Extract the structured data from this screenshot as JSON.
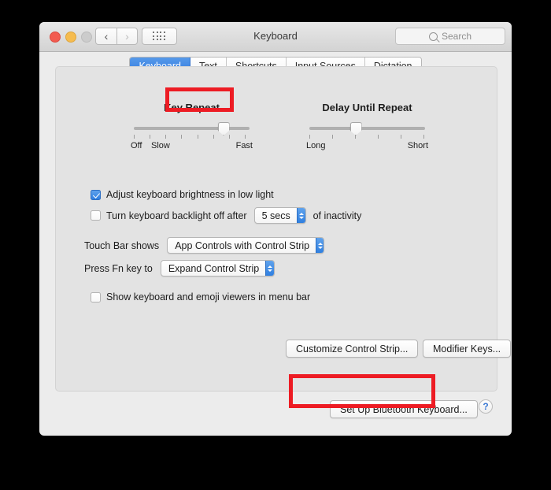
{
  "window": {
    "title": "Keyboard",
    "traffic_lights": [
      "close",
      "minimize",
      "zoom"
    ],
    "nav_back_icon": "chevron-left-icon",
    "nav_forward_icon": "chevron-right-icon",
    "grid_icon": "show-all-grid-icon",
    "search": {
      "placeholder": "Search",
      "value": "",
      "icon": "search-icon"
    }
  },
  "tabs": [
    {
      "label": "Keyboard",
      "active": true
    },
    {
      "label": "Text",
      "active": false
    },
    {
      "label": "Shortcuts",
      "active": false
    },
    {
      "label": "Input Sources",
      "active": false
    },
    {
      "label": "Dictation",
      "active": false
    }
  ],
  "sliders": [
    {
      "title": "Key Repeat",
      "left_label": "Off",
      "second_label": "Slow",
      "right_label": "Fast",
      "ticks": 8,
      "value_index": 7
    },
    {
      "title": "Delay Until Repeat",
      "left_label": "Long",
      "right_label": "Short",
      "ticks": 6,
      "value_index": 3
    }
  ],
  "checkboxes": [
    {
      "label": "Adjust keyboard brightness in low light",
      "checked": true
    },
    {
      "label": "Turn keyboard backlight off after",
      "checked": false,
      "suffix": "of inactivity"
    },
    {
      "label": "Show keyboard and emoji viewers in menu bar",
      "checked": false
    }
  ],
  "popups": {
    "backlight_timeout": {
      "value": "5 secs",
      "stepper_icon": "stepper-up-down-icon"
    },
    "touch_bar_shows": {
      "label": "Touch Bar shows",
      "value": "App Controls with Control Strip",
      "stepper_icon": "stepper-up-down-icon"
    },
    "press_fn_key_to": {
      "label": "Press Fn key to",
      "value": "Expand Control Strip",
      "stepper_icon": "stepper-up-down-icon"
    }
  },
  "buttons": {
    "customize_control_strip": "Customize Control Strip...",
    "modifier_keys": "Modifier Keys...",
    "set_up_bluetooth_keyboard": "Set Up Bluetooth Keyboard...",
    "help": "?"
  },
  "annotations": {
    "color": "#ed1c24",
    "boxes": [
      "keyboard-tab",
      "customize-control-strip-button"
    ]
  }
}
